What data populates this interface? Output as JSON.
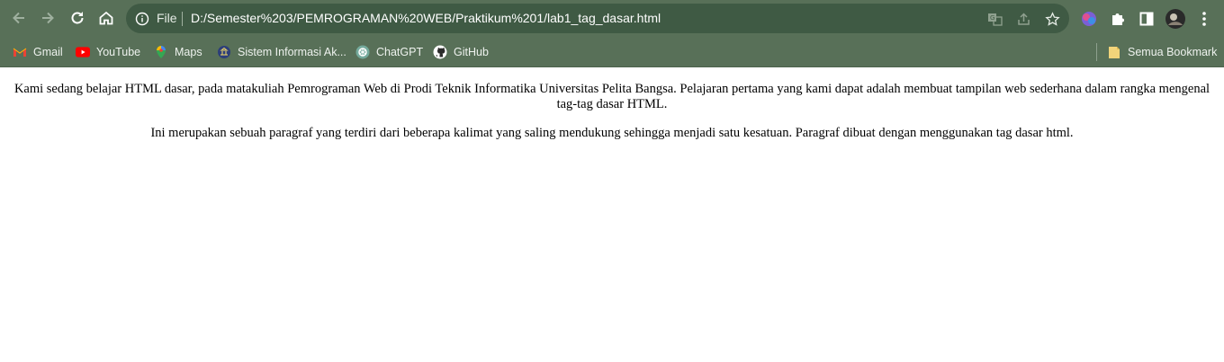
{
  "browser": {
    "address_bar": {
      "scheme_label": "File",
      "url": "D:/Semester%203/PEMROGRAMAN%20WEB/Praktikum%201/lab1_tag_dasar.html"
    },
    "icons": {
      "back": "arrow-left-icon",
      "forward": "arrow-right-icon",
      "reload": "reload-icon",
      "home": "home-icon",
      "info": "info-icon",
      "translate": "translate-icon",
      "share": "share-icon",
      "bookmark_star": "star-icon",
      "copilot": "copilot-icon",
      "extensions": "puzzle-icon",
      "side_panel": "side-panel-icon",
      "profile": "avatar",
      "menu": "kebab-menu-icon"
    },
    "colors": {
      "chrome_bg": "#587058",
      "omnibox_bg": "#3f5a44"
    }
  },
  "bookmarks": {
    "items": [
      {
        "label": "Gmail",
        "icon": "gmail-icon"
      },
      {
        "label": "YouTube",
        "icon": "youtube-icon"
      },
      {
        "label": "Maps",
        "icon": "maps-icon"
      },
      {
        "label": "Sistem Informasi Ak...",
        "icon": "university-icon"
      },
      {
        "label": "ChatGPT",
        "icon": "chatgpt-icon"
      },
      {
        "label": "GitHub",
        "icon": "github-icon"
      }
    ],
    "all_bookmarks": {
      "label": "Semua Bookmark",
      "icon": "folder-icon"
    }
  },
  "page": {
    "paragraphs": [
      "Kami sedang belajar HTML dasar, pada matakuliah Pemrograman Web di Prodi Teknik Informatika Universitas Pelita Bangsa. Pelajaran pertama yang kami dapat adalah membuat tampilan web sederhana dalam rangka mengenal tag-tag dasar HTML.",
      "Ini merupakan sebuah paragraf yang terdiri dari beberapa kalimat yang saling mendukung sehingga menjadi satu kesatuan. Paragraf dibuat dengan menggunakan tag dasar html."
    ]
  }
}
